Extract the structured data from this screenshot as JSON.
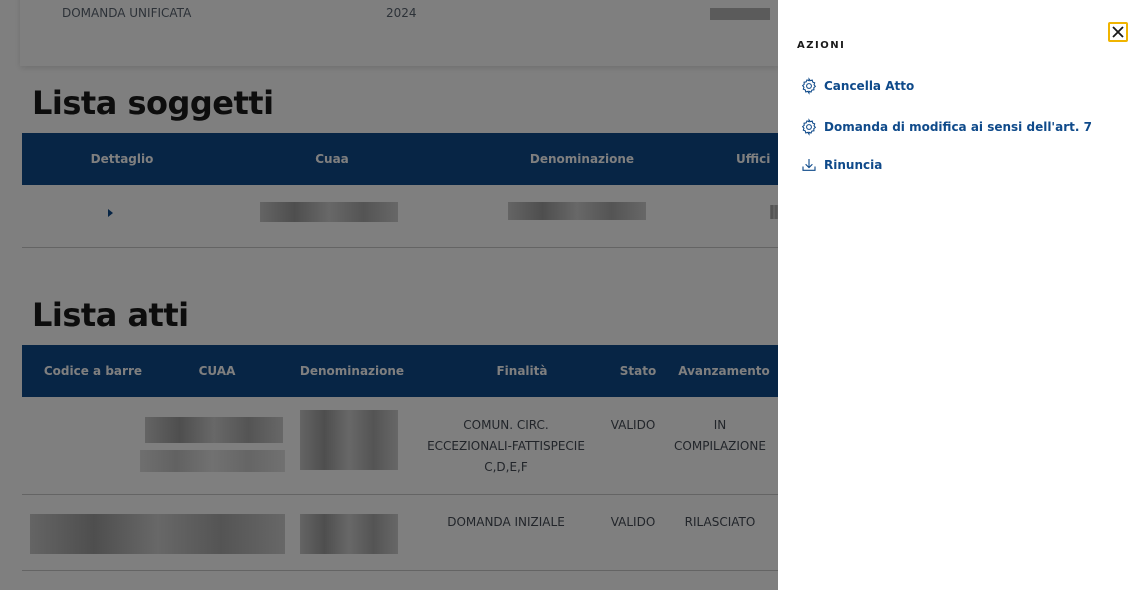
{
  "top_card": {
    "domanda_label": "DOMANDA UNIFICATA",
    "year": "2024"
  },
  "lista_soggetti": {
    "title": "Lista soggetti",
    "columns": [
      "Dettaglio",
      "Cuaa",
      "Denominazione",
      "Uffici"
    ]
  },
  "lista_atti": {
    "title": "Lista atti",
    "columns": [
      "Codice a barre",
      "CUAA",
      "Denominazione",
      "Finalità",
      "Stato",
      "Avanzamento"
    ],
    "rows": [
      {
        "finalita": "COMUN. CIRC. ECCEZIONALI-FATTISPECIE C,D,E,F",
        "stato": "VALIDO",
        "avanzamento": "IN COMPILAZIONE"
      },
      {
        "finalita": "DOMANDA INIZIALE",
        "stato": "VALIDO",
        "avanzamento": "RILASCIATO"
      }
    ]
  },
  "panel": {
    "title": "AZIONI",
    "actions": [
      {
        "label": "Cancella Atto",
        "icon": "gear-icon"
      },
      {
        "label": "Domanda di modifica ai sensi dell'art. 7",
        "icon": "gear-icon"
      },
      {
        "label": "Rinuncia",
        "icon": "download-icon"
      }
    ],
    "close_icon": "close-icon"
  },
  "colors": {
    "header_bg": "#0f4a8a",
    "link": "#0f4a8a",
    "close_border": "#f0b400"
  }
}
